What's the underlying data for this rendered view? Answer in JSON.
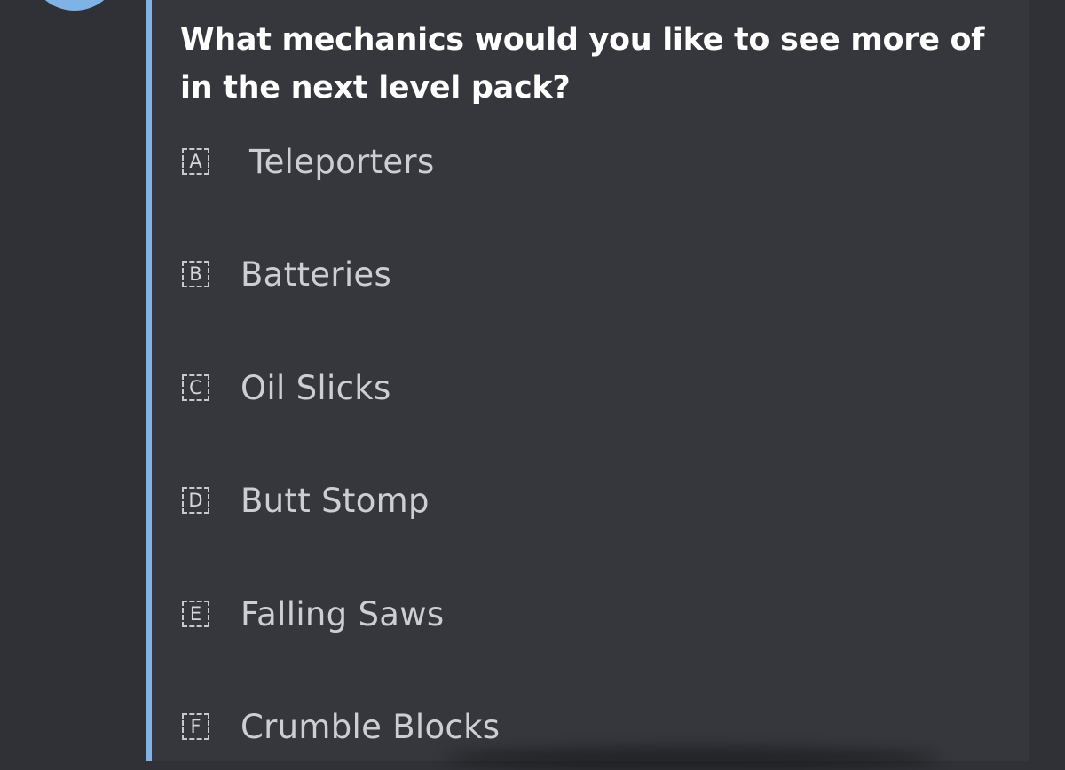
{
  "poll": {
    "question": "What mechanics would you like to see more of in the next level pack?",
    "options": [
      {
        "letter": "A",
        "label": "Teleporters"
      },
      {
        "letter": "B",
        "label": "Batteries"
      },
      {
        "letter": "C",
        "label": "Oil Slicks"
      },
      {
        "letter": "D",
        "label": "Butt Stomp"
      },
      {
        "letter": "E",
        "label": "Falling Saws"
      },
      {
        "letter": "F",
        "label": "Crumble Blocks"
      }
    ]
  },
  "colors": {
    "background": "#2f3136",
    "embed_background": "#36373c",
    "accent": "#7fb3e6"
  }
}
